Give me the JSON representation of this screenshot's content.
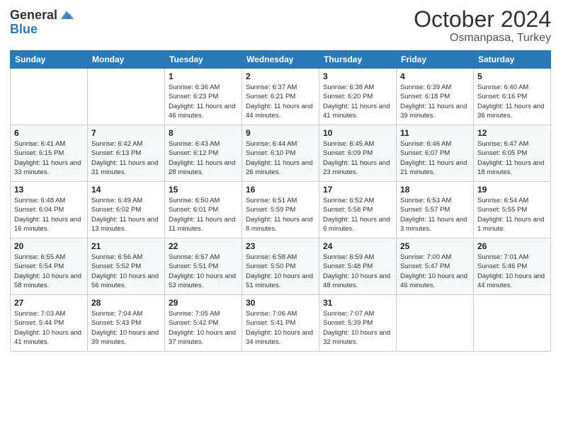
{
  "header": {
    "logo": {
      "general": "General",
      "blue": "Blue"
    },
    "title": "October 2024",
    "location": "Osmanpasa, Turkey"
  },
  "days_of_week": [
    "Sunday",
    "Monday",
    "Tuesday",
    "Wednesday",
    "Thursday",
    "Friday",
    "Saturday"
  ],
  "weeks": [
    [
      {
        "day": "",
        "info": ""
      },
      {
        "day": "",
        "info": ""
      },
      {
        "day": "1",
        "info": "Sunrise: 6:36 AM\nSunset: 6:23 PM\nDaylight: 11 hours and 46 minutes."
      },
      {
        "day": "2",
        "info": "Sunrise: 6:37 AM\nSunset: 6:21 PM\nDaylight: 11 hours and 44 minutes."
      },
      {
        "day": "3",
        "info": "Sunrise: 6:38 AM\nSunset: 6:20 PM\nDaylight: 11 hours and 41 minutes."
      },
      {
        "day": "4",
        "info": "Sunrise: 6:39 AM\nSunset: 6:18 PM\nDaylight: 11 hours and 39 minutes."
      },
      {
        "day": "5",
        "info": "Sunrise: 6:40 AM\nSunset: 6:16 PM\nDaylight: 11 hours and 36 minutes."
      }
    ],
    [
      {
        "day": "6",
        "info": "Sunrise: 6:41 AM\nSunset: 6:15 PM\nDaylight: 11 hours and 33 minutes."
      },
      {
        "day": "7",
        "info": "Sunrise: 6:42 AM\nSunset: 6:13 PM\nDaylight: 11 hours and 31 minutes."
      },
      {
        "day": "8",
        "info": "Sunrise: 6:43 AM\nSunset: 6:12 PM\nDaylight: 11 hours and 28 minutes."
      },
      {
        "day": "9",
        "info": "Sunrise: 6:44 AM\nSunset: 6:10 PM\nDaylight: 11 hours and 26 minutes."
      },
      {
        "day": "10",
        "info": "Sunrise: 6:45 AM\nSunset: 6:09 PM\nDaylight: 11 hours and 23 minutes."
      },
      {
        "day": "11",
        "info": "Sunrise: 6:46 AM\nSunset: 6:07 PM\nDaylight: 11 hours and 21 minutes."
      },
      {
        "day": "12",
        "info": "Sunrise: 6:47 AM\nSunset: 6:05 PM\nDaylight: 11 hours and 18 minutes."
      }
    ],
    [
      {
        "day": "13",
        "info": "Sunrise: 6:48 AM\nSunset: 6:04 PM\nDaylight: 11 hours and 16 minutes."
      },
      {
        "day": "14",
        "info": "Sunrise: 6:49 AM\nSunset: 6:02 PM\nDaylight: 11 hours and 13 minutes."
      },
      {
        "day": "15",
        "info": "Sunrise: 6:50 AM\nSunset: 6:01 PM\nDaylight: 11 hours and 11 minutes."
      },
      {
        "day": "16",
        "info": "Sunrise: 6:51 AM\nSunset: 5:59 PM\nDaylight: 11 hours and 8 minutes."
      },
      {
        "day": "17",
        "info": "Sunrise: 6:52 AM\nSunset: 5:58 PM\nDaylight: 11 hours and 6 minutes."
      },
      {
        "day": "18",
        "info": "Sunrise: 6:53 AM\nSunset: 5:57 PM\nDaylight: 11 hours and 3 minutes."
      },
      {
        "day": "19",
        "info": "Sunrise: 6:54 AM\nSunset: 5:55 PM\nDaylight: 11 hours and 1 minute."
      }
    ],
    [
      {
        "day": "20",
        "info": "Sunrise: 6:55 AM\nSunset: 5:54 PM\nDaylight: 10 hours and 58 minutes."
      },
      {
        "day": "21",
        "info": "Sunrise: 6:56 AM\nSunset: 5:52 PM\nDaylight: 10 hours and 56 minutes."
      },
      {
        "day": "22",
        "info": "Sunrise: 6:57 AM\nSunset: 5:51 PM\nDaylight: 10 hours and 53 minutes."
      },
      {
        "day": "23",
        "info": "Sunrise: 6:58 AM\nSunset: 5:50 PM\nDaylight: 10 hours and 51 minutes."
      },
      {
        "day": "24",
        "info": "Sunrise: 6:59 AM\nSunset: 5:48 PM\nDaylight: 10 hours and 48 minutes."
      },
      {
        "day": "25",
        "info": "Sunrise: 7:00 AM\nSunset: 5:47 PM\nDaylight: 10 hours and 46 minutes."
      },
      {
        "day": "26",
        "info": "Sunrise: 7:01 AM\nSunset: 5:46 PM\nDaylight: 10 hours and 44 minutes."
      }
    ],
    [
      {
        "day": "27",
        "info": "Sunrise: 7:03 AM\nSunset: 5:44 PM\nDaylight: 10 hours and 41 minutes."
      },
      {
        "day": "28",
        "info": "Sunrise: 7:04 AM\nSunset: 5:43 PM\nDaylight: 10 hours and 39 minutes."
      },
      {
        "day": "29",
        "info": "Sunrise: 7:05 AM\nSunset: 5:42 PM\nDaylight: 10 hours and 37 minutes."
      },
      {
        "day": "30",
        "info": "Sunrise: 7:06 AM\nSunset: 5:41 PM\nDaylight: 10 hours and 34 minutes."
      },
      {
        "day": "31",
        "info": "Sunrise: 7:07 AM\nSunset: 5:39 PM\nDaylight: 10 hours and 32 minutes."
      },
      {
        "day": "",
        "info": ""
      },
      {
        "day": "",
        "info": ""
      }
    ]
  ]
}
